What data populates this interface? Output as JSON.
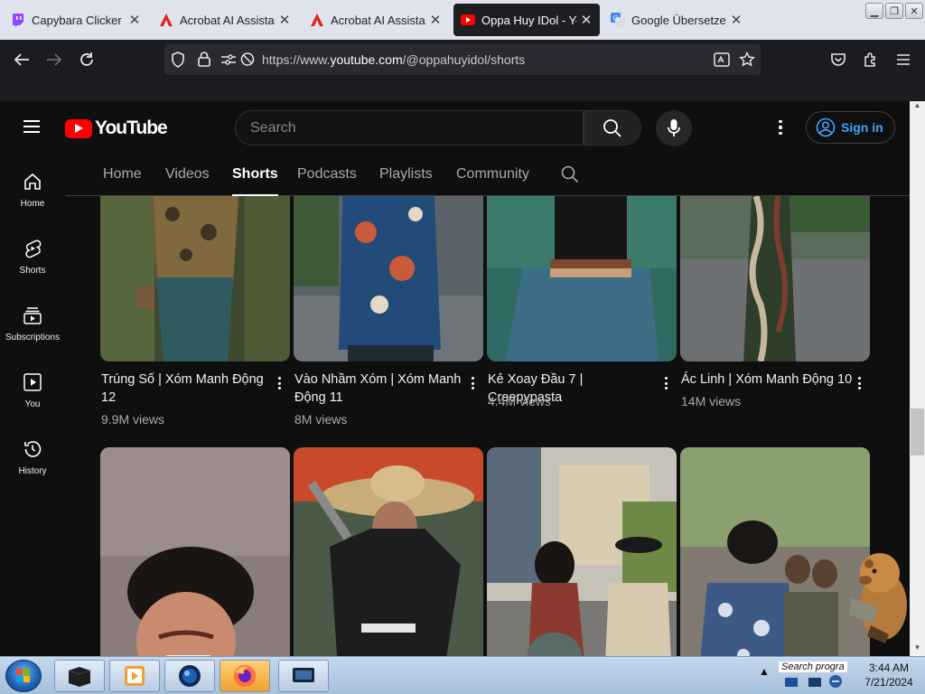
{
  "browser": {
    "tabs": [
      {
        "title": "Capybara Clicker",
        "icon": "twitch-icon",
        "active": false
      },
      {
        "title": "Acrobat AI Assistant:",
        "icon": "acrobat-icon",
        "active": false
      },
      {
        "title": "Acrobat AI Assistant:",
        "icon": "acrobat-icon",
        "active": false
      },
      {
        "title": "Oppa Huy IDol - You",
        "icon": "youtube-icon",
        "active": true
      },
      {
        "title": "Google Übersetzer",
        "icon": "google-translate-icon",
        "active": false
      }
    ],
    "url_prefix": "https://www.",
    "url_host": "youtube.com",
    "url_path": "/@oppahuyidol/shorts"
  },
  "youtube": {
    "logo_text": "YouTube",
    "search_placeholder": "Search",
    "sign_in": "Sign in",
    "guide": [
      {
        "label": "Home",
        "icon": "home-icon"
      },
      {
        "label": "Shorts",
        "icon": "shorts-icon"
      },
      {
        "label": "Subscriptions",
        "icon": "subscriptions-icon"
      },
      {
        "label": "You",
        "icon": "you-icon"
      },
      {
        "label": "History",
        "icon": "history-icon"
      }
    ],
    "channel_tabs": [
      "Home",
      "Videos",
      "Shorts",
      "Podcasts",
      "Playlists",
      "Community"
    ],
    "active_tab": "Shorts",
    "shorts_row1": [
      {
        "title": "Trúng Số | Xóm Manh Động 12",
        "views": "9.9M views"
      },
      {
        "title": "Vào Nhầm Xóm | Xóm Manh Động 11",
        "views": "8M views"
      },
      {
        "title": "Kẻ Xoay Đầu 7 | Creepypasta",
        "views": "4.4M views"
      },
      {
        "title": "Ác Linh | Xóm Manh Động 10",
        "views": "14M views"
      }
    ]
  },
  "taskbar": {
    "search_text": "Search progra",
    "time": "3:44 AM",
    "date": "7/21/2024"
  }
}
